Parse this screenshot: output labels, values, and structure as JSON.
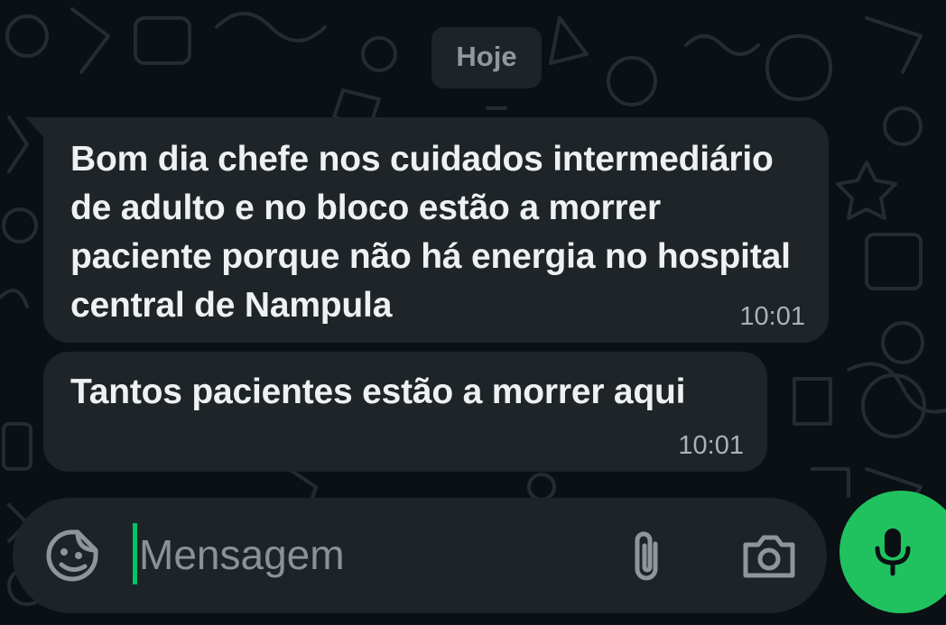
{
  "chat": {
    "date_label": "Hoje",
    "messages": [
      {
        "text": "Bom dia chefe nos cuidados intermediário de adulto e no bloco estão a morrer paciente porque não há energia no hospital central de Nampula",
        "time": "10:01"
      },
      {
        "text": "Tantos pacientes estão a morrer aqui",
        "time": "10:01"
      }
    ]
  },
  "composer": {
    "placeholder": "Mensagem",
    "value": "",
    "icons": {
      "emoji": "sticker-emoji-icon",
      "attach": "paperclip-icon",
      "camera": "camera-icon",
      "mic": "microphone-icon"
    }
  },
  "colors": {
    "background": "#0b1014",
    "bubble": "#1e2428",
    "accent": "#20c25f",
    "caret": "#00c36b",
    "muted_text": "#8e989d"
  }
}
